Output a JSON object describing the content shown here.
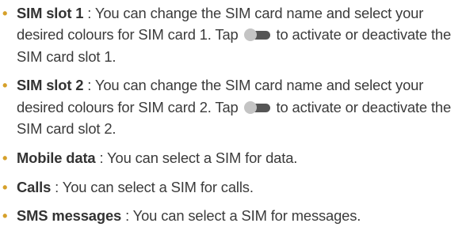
{
  "colors": {
    "bullet": "#d6a02a",
    "text": "#3b3b3b",
    "toggle_track": "#555555",
    "toggle_knob": "#c4c4c4"
  },
  "bullet_glyph": "•",
  "items": [
    {
      "term": "SIM slot 1",
      "text_before_toggle": " : You can change the SIM card name and select your desired colours for SIM card 1. Tap ",
      "toggle_icon": "switch-toggle-icon",
      "text_after_toggle": " to activate or deactivate the SIM card slot 1."
    },
    {
      "term": "SIM slot 2",
      "text_before_toggle": " : You can change the SIM card name and select your desired colours for SIM card 2. Tap ",
      "toggle_icon": "switch-toggle-icon",
      "text_after_toggle": " to activate or deactivate the SIM card slot 2."
    },
    {
      "term": "Mobile data",
      "text": " : You can select a SIM for data."
    },
    {
      "term": "Calls",
      "text": " : You can select a SIM for calls."
    },
    {
      "term": "SMS messages",
      "text": " : You can select a SIM for messages."
    }
  ]
}
